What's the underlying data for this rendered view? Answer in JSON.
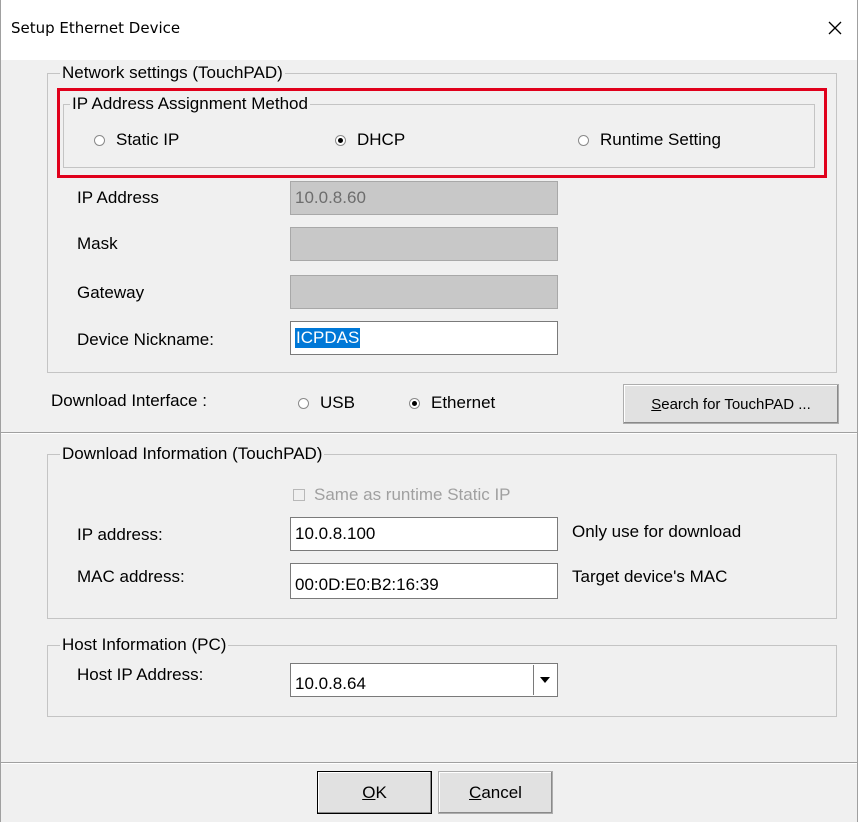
{
  "window": {
    "title": "Setup Ethernet Device"
  },
  "network_settings": {
    "legend": "Network settings (TouchPAD)",
    "ip_method": {
      "legend": "IP Address Assignment Method",
      "options": [
        {
          "label": "Static IP",
          "checked": false
        },
        {
          "label": "DHCP",
          "checked": true
        },
        {
          "label": "Runtime Setting",
          "checked": false
        }
      ]
    },
    "ip_address": {
      "label": "IP Address",
      "value": "10.0.8.60"
    },
    "mask": {
      "label": "Mask",
      "value": ""
    },
    "gateway": {
      "label": "Gateway",
      "value": ""
    },
    "nickname": {
      "label": "Device Nickname:",
      "value": "ICPDAS"
    }
  },
  "download_interface": {
    "label": "Download Interface :",
    "options": [
      {
        "label": "USB",
        "checked": false
      },
      {
        "label": "Ethernet",
        "checked": true
      }
    ],
    "search_button": {
      "pre": "",
      "accel": "S",
      "rest": "earch for TouchPAD ..."
    }
  },
  "download_info": {
    "legend": "Download Information (TouchPAD)",
    "same_as_static": {
      "label": "Same as runtime Static IP",
      "checked": false
    },
    "ip_address": {
      "label": "IP address:",
      "value": "10.0.8.100",
      "note": "Only use for download"
    },
    "mac_address": {
      "label": "MAC address:",
      "value": "00:0D:E0:B2:16:39",
      "note": "Target device's MAC"
    }
  },
  "host_info": {
    "legend": "Host Information (PC)",
    "host_ip": {
      "label": "Host IP Address:",
      "value": "10.0.8.64"
    }
  },
  "buttons": {
    "ok": {
      "accel": "O",
      "rest": "K"
    },
    "cancel": {
      "accel": "C",
      "rest": "ancel"
    }
  },
  "colors": {
    "highlight": "#e0001b",
    "selection": "#0078d7",
    "dialog_bg": "#f0f0f0"
  }
}
